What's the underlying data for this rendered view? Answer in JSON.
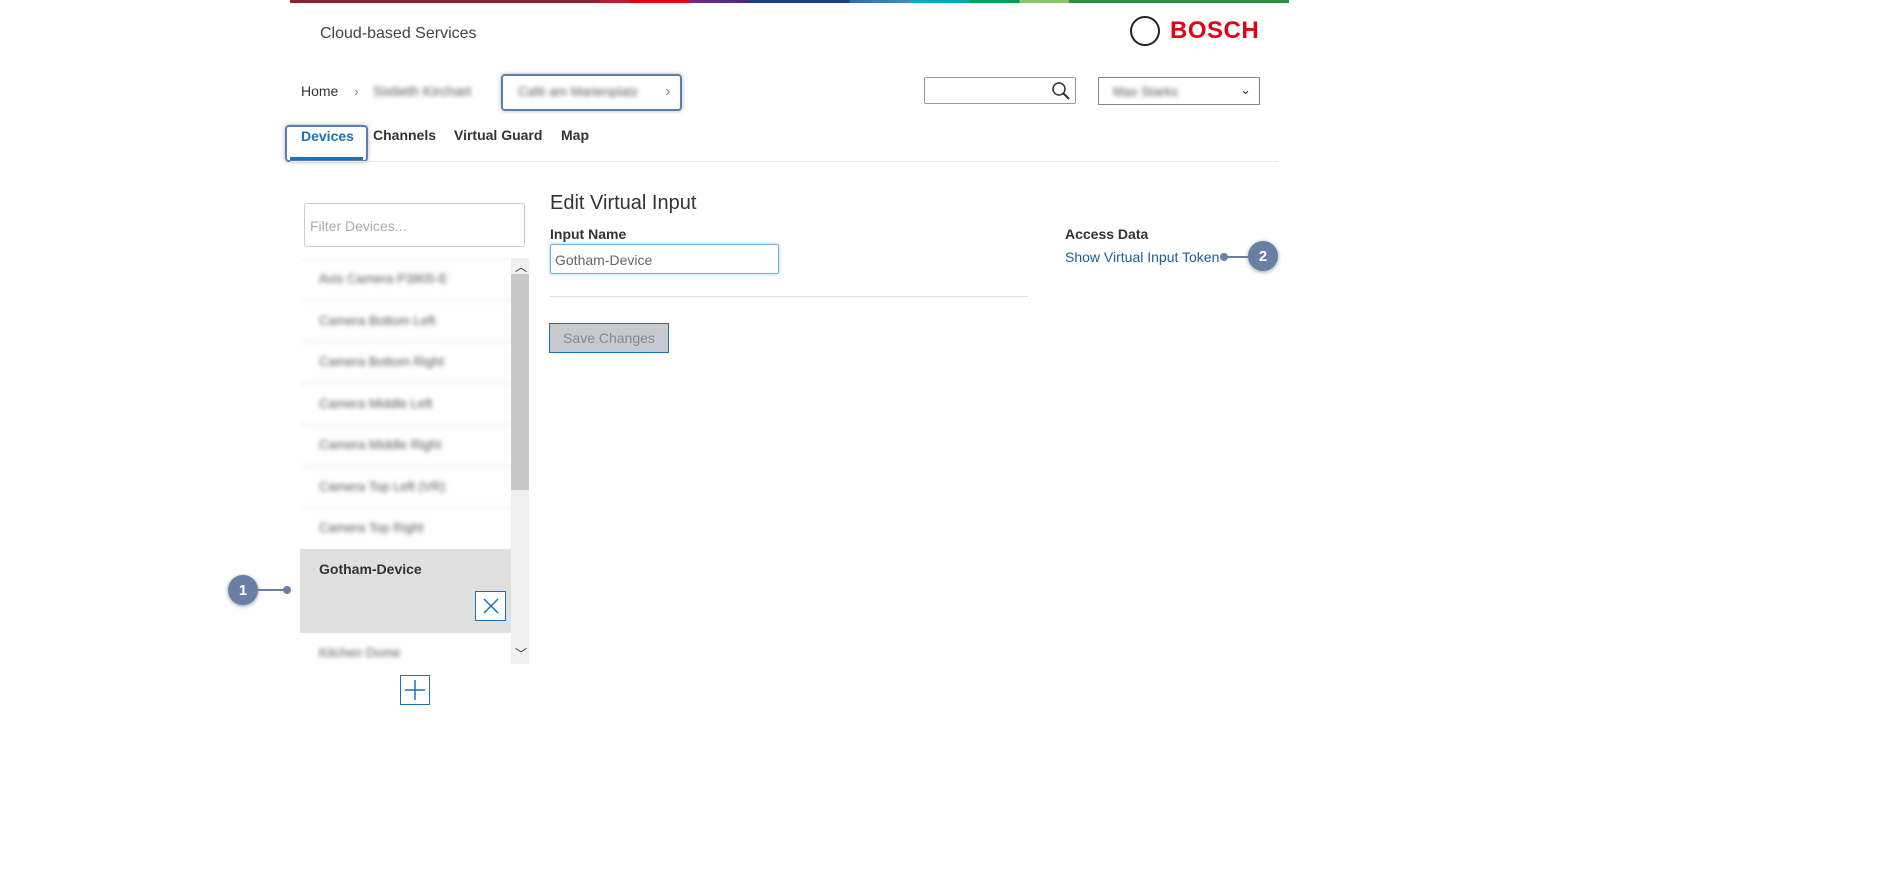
{
  "header": {
    "app_title": "Cloud-based Services",
    "brand": "BOSCH"
  },
  "breadcrumb": {
    "home": "Home",
    "level1": "Sixtieth Kirchart",
    "level2": "Café am Marienplatz",
    "sep": "›"
  },
  "user_menu": {
    "selected": "Max Starks"
  },
  "tabs": [
    {
      "label": "Devices",
      "active": true
    },
    {
      "label": "Channels"
    },
    {
      "label": "Virtual Guard"
    },
    {
      "label": "Map"
    }
  ],
  "sidebar": {
    "filter_placeholder": "Filter Devices...",
    "devices": [
      "Axis Camera P3905-E",
      "Camera Bottom Left",
      "Camera Bottom Right",
      "Camera Middle Left",
      "Camera Middle Right",
      "Camera Top Left (VR)",
      "Camera Top Right"
    ],
    "selected": "Gotham-Device",
    "after": "Kitchen Dome"
  },
  "form": {
    "title": "Edit Virtual Input",
    "input_label": "Input Name",
    "input_value": "Gotham-Device",
    "save_label": "Save Changes"
  },
  "access": {
    "title": "Access Data",
    "link": "Show Virtual Input Token"
  },
  "callouts": [
    "1",
    "2"
  ]
}
